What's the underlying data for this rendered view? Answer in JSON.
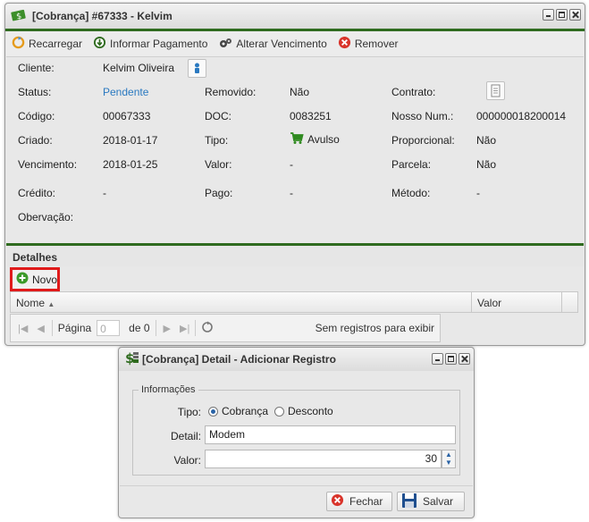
{
  "main_window": {
    "title": "[Cobrança] #67333 - Kelvim",
    "toolbar": {
      "reload": "Recarregar",
      "inform_payment": "Informar Pagamento",
      "change_due": "Alterar Vencimento",
      "remove": "Remover"
    },
    "fields": {
      "cliente_label": "Cliente:",
      "cliente_value": "Kelvim Oliveira",
      "status_label": "Status:",
      "status_value": "Pendente",
      "removido_label": "Removido:",
      "removido_value": "Não",
      "contrato_label": "Contrato:",
      "codigo_label": "Código:",
      "codigo_value": "00067333",
      "doc_label": "DOC:",
      "doc_value": "0083251",
      "nosso_label": "Nosso Num.:",
      "nosso_value": "000000018200014",
      "criado_label": "Criado:",
      "criado_value": "2018-01-17",
      "tipo_label": "Tipo:",
      "tipo_value": "Avulso",
      "proporcional_label": "Proporcional:",
      "proporcional_value": "Não",
      "vencimento_label": "Vencimento:",
      "vencimento_value": "2018-01-25",
      "valor_label": "Valor:",
      "valor_value": "-",
      "parcela_label": "Parcela:",
      "parcela_value": "Não",
      "credito_label": "Crédito:",
      "credito_value": "-",
      "pago_label": "Pago:",
      "pago_value": "-",
      "metodo_label": "Método:",
      "metodo_value": "-",
      "observacao_label": "Obervação:"
    },
    "details": {
      "header": "Detalhes",
      "new_button": "Novo",
      "columns": [
        "Nome",
        "Valor"
      ],
      "pager": {
        "page_label": "Página",
        "page_value": "0",
        "of_label": "de 0",
        "status": "Sem registros para exibir"
      }
    },
    "colors": {
      "accent": "#2f6b1f",
      "link": "#2a79c0",
      "highlight": "#e01b1b"
    }
  },
  "dialog": {
    "title": "[Cobrança] Detail - Adicionar Registro",
    "group": "Informações",
    "tipo_label": "Tipo:",
    "tipo_options": [
      "Cobrança",
      "Desconto"
    ],
    "tipo_selected": "Cobrança",
    "detail_label": "Detail:",
    "detail_value": "Modem",
    "valor_label": "Valor:",
    "valor_value": "30",
    "close_button": "Fechar",
    "save_button": "Salvar"
  }
}
